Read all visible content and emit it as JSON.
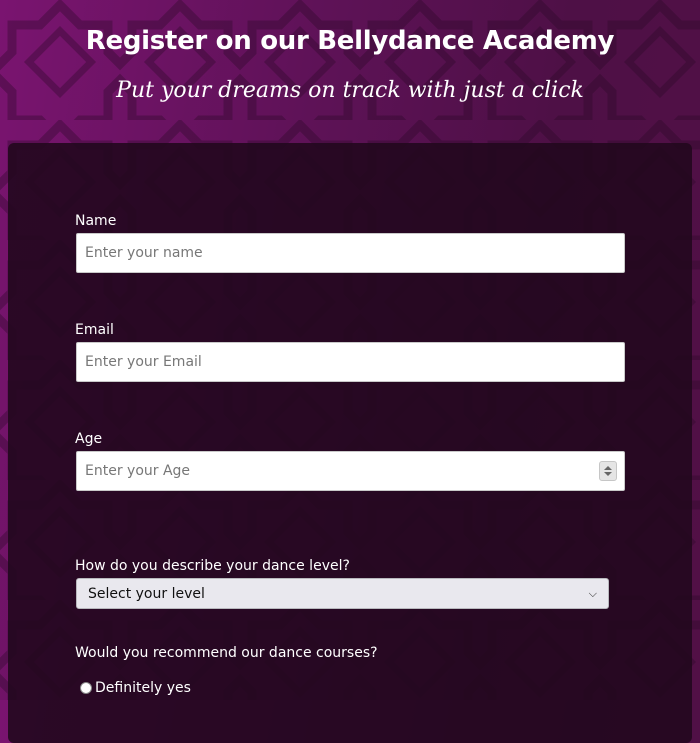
{
  "header": {
    "title": "Register on our Bellydance Academy",
    "subtitle": "Put your dreams on track with just a click"
  },
  "form": {
    "name": {
      "label": "Name",
      "placeholder": "Enter your name",
      "value": ""
    },
    "email": {
      "label": "Email",
      "placeholder": "Enter your Email",
      "value": ""
    },
    "age": {
      "label": "Age",
      "placeholder": "Enter your Age",
      "value": ""
    },
    "level": {
      "label": "How do you describe your dance level?",
      "selected": "Select your level"
    },
    "recommend": {
      "label": "Would you recommend our dance courses?",
      "options": [
        "Definitely yes"
      ]
    }
  },
  "colors": {
    "background": "#5e1257",
    "card": "#22081e",
    "text": "#ffffff"
  }
}
